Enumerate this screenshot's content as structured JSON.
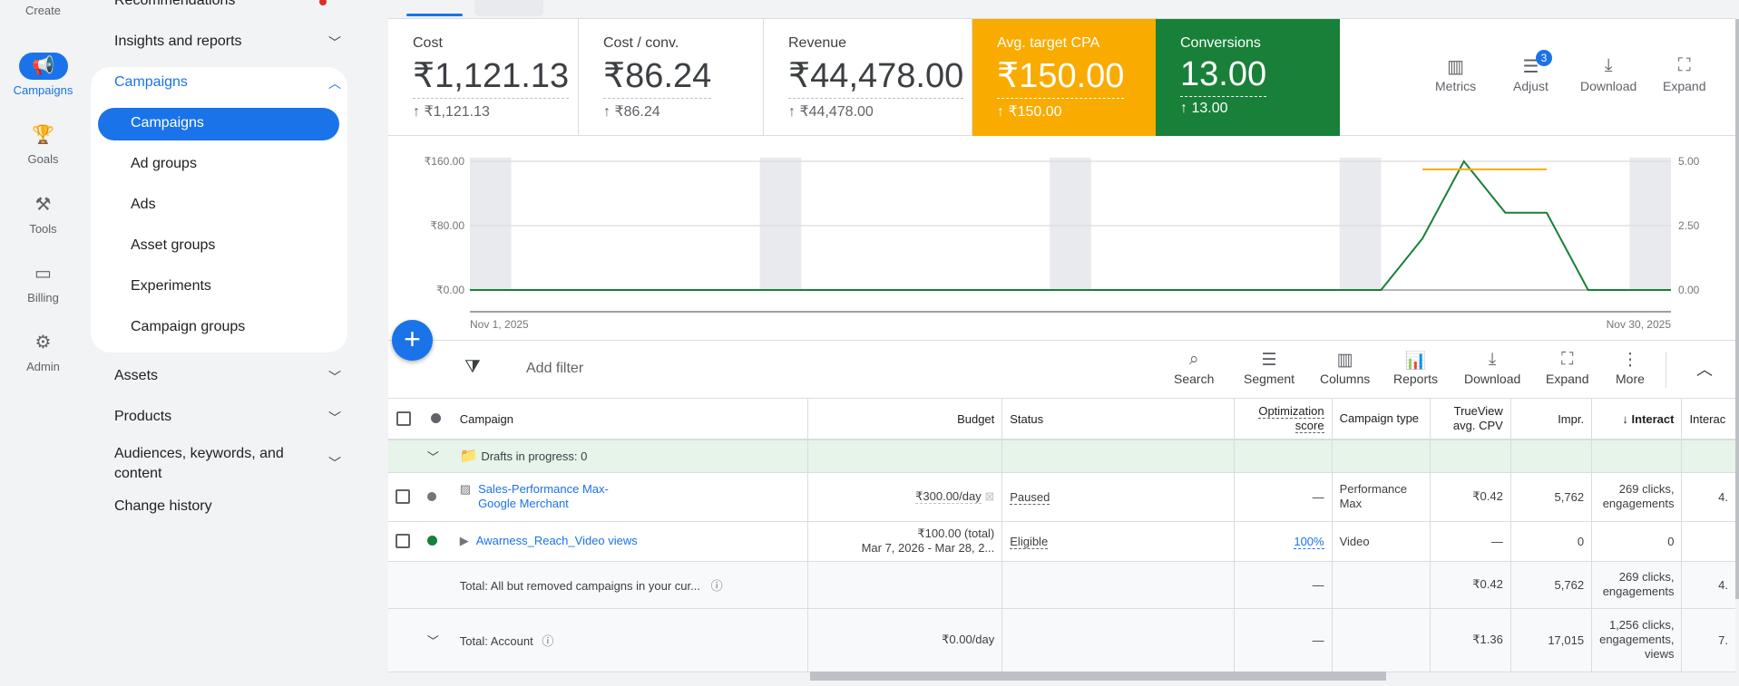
{
  "rail": {
    "create": "Create",
    "items": [
      {
        "label": "Campaigns",
        "icon": "megaphone-icon"
      },
      {
        "label": "Goals",
        "icon": "trophy-icon"
      },
      {
        "label": "Tools",
        "icon": "tools-icon"
      },
      {
        "label": "Billing",
        "icon": "credit-card-icon"
      },
      {
        "label": "Admin",
        "icon": "gear-icon"
      }
    ]
  },
  "nav": {
    "recommendations": "Recommendations",
    "insights": "Insights and reports",
    "campaigns_section": "Campaigns",
    "sub": [
      "Campaigns",
      "Ad groups",
      "Ads",
      "Asset groups",
      "Experiments",
      "Campaign groups"
    ],
    "assets": "Assets",
    "products": "Products",
    "audiences": "Audiences, keywords, and content",
    "change_history": "Change history"
  },
  "cards": [
    {
      "label": "Cost",
      "value": "₹1,121.13",
      "change": "↑ ₹1,121.13"
    },
    {
      "label": "Cost / conv.",
      "value": "₹86.24",
      "change": "↑ ₹86.24"
    },
    {
      "label": "Revenue",
      "value": "₹44,478.00",
      "change": "↑ ₹44,478.00"
    },
    {
      "label": "Avg. target CPA",
      "value": "₹150.00",
      "change": "↑ ₹150.00",
      "color": "#f9ab00"
    },
    {
      "label": "Conversions",
      "value": "13.00",
      "change": "↑ 13.00",
      "color": "#188038"
    }
  ],
  "card_tools": {
    "metrics": "Metrics",
    "adjust": "Adjust",
    "adjust_badge": "3",
    "download": "Download",
    "expand": "Expand"
  },
  "chart_data": {
    "type": "line",
    "x_start_label": "Nov 1, 2025",
    "x_end_label": "Nov 30, 2025",
    "x": [
      "Nov 1",
      "Nov 2",
      "Nov 3",
      "Nov 4",
      "Nov 5",
      "Nov 6",
      "Nov 7",
      "Nov 8",
      "Nov 9",
      "Nov 10",
      "Nov 11",
      "Nov 12",
      "Nov 13",
      "Nov 14",
      "Nov 15",
      "Nov 16",
      "Nov 17",
      "Nov 18",
      "Nov 19",
      "Nov 20",
      "Nov 21",
      "Nov 22",
      "Nov 23",
      "Nov 24",
      "Nov 25",
      "Nov 26",
      "Nov 27",
      "Nov 28",
      "Nov 29",
      "Nov 30"
    ],
    "left_axis": {
      "ticks": [
        "₹0.00",
        "₹80.00",
        "₹160.00"
      ],
      "range": [
        0,
        160
      ]
    },
    "right_axis": {
      "ticks": [
        "0.00",
        "2.50",
        "5.00"
      ],
      "range": [
        0,
        5
      ]
    },
    "series": [
      {
        "name": "Conversions",
        "axis": "right",
        "color": "#188038",
        "values": [
          0,
          0,
          0,
          0,
          0,
          0,
          0,
          0,
          0,
          0,
          0,
          0,
          0,
          0,
          0,
          0,
          0,
          0,
          0,
          0,
          0,
          0,
          0,
          2,
          5,
          3,
          3,
          0,
          0,
          0
        ]
      },
      {
        "name": "Avg. target CPA",
        "axis": "left",
        "color": "#f9ab00",
        "values": [
          null,
          null,
          null,
          null,
          null,
          null,
          null,
          null,
          null,
          null,
          null,
          null,
          null,
          null,
          null,
          null,
          null,
          null,
          null,
          null,
          null,
          null,
          null,
          150,
          150,
          150,
          150,
          null,
          null,
          null
        ]
      }
    ],
    "weekend_bands": [
      [
        "Nov 1",
        "Nov 2"
      ],
      [
        "Nov 8",
        "Nov 9"
      ],
      [
        "Nov 15",
        "Nov 16"
      ],
      [
        "Nov 22",
        "Nov 23"
      ],
      [
        "Nov 29",
        "Nov 30"
      ]
    ],
    "grid": true
  },
  "toolbar": {
    "add_filter": "Add filter",
    "buttons": [
      "Search",
      "Segment",
      "Columns",
      "Reports",
      "Download",
      "Expand",
      "More"
    ]
  },
  "table": {
    "headers": {
      "campaign": "Campaign",
      "budget": "Budget",
      "status": "Status",
      "opt_score": "Optimization score",
      "campaign_type": "Campaign type",
      "trueview": "TrueView avg. CPV",
      "impr": "Impr.",
      "interactions": "Interact",
      "interaction_rate": "Interac"
    },
    "drafts": "Drafts in progress: 0",
    "rows": [
      {
        "campaign": "Sales-Performance Max-Google Merchant",
        "status_dot": "paused",
        "budget": "₹300.00/day",
        "status": "Paused",
        "opt_score": "—",
        "campaign_type": "Performance Max",
        "trueview": "₹0.42",
        "impr": "5,762",
        "interactions": "269 clicks, engagements",
        "interaction_rate": "4."
      },
      {
        "campaign": "Awarness_Reach_Video views",
        "status_dot": "enabled",
        "budget": "₹100.00 (total)",
        "budget_dates": "Mar 7, 2026 - Mar 28, 2...",
        "status": "Eligible",
        "opt_score": "100%",
        "campaign_type": "Video",
        "trueview": "—",
        "impr": "0",
        "interactions": "0",
        "interaction_rate": ""
      }
    ],
    "totals": [
      {
        "label": "Total: All but removed campaigns in your cur...",
        "budget": "",
        "opt_score": "—",
        "trueview": "₹0.42",
        "impr": "5,762",
        "interactions": "269 clicks, engagements",
        "interaction_rate": "4."
      },
      {
        "label": "Total: Account",
        "budget": "₹0.00/day",
        "opt_score": "—",
        "trueview": "₹1.36",
        "impr": "17,015",
        "interactions": "1,256 clicks, engagements, views",
        "interaction_rate": "7."
      }
    ]
  }
}
